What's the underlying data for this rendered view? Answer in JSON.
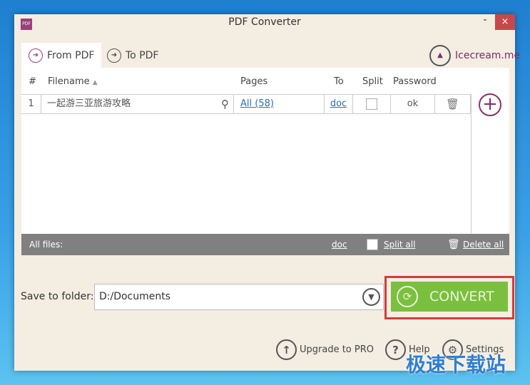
{
  "window": {
    "title": "PDF Converter",
    "icon_text": "PDF",
    "minimize": "-",
    "close": "×"
  },
  "tabs": [
    {
      "label": "From PDF",
      "active": true
    },
    {
      "label": "To PDF",
      "active": false
    }
  ],
  "brand": {
    "label": "Icecream.me"
  },
  "table": {
    "headers": {
      "num": "#",
      "filename": "Filename",
      "pages": "Pages",
      "to": "To",
      "split": "Split",
      "password": "Password"
    },
    "rows": [
      {
        "num": "1",
        "filename": "一起游三亚旅游攻略",
        "pages": "All (58)",
        "to": "doc",
        "split": false,
        "password": "ok"
      }
    ]
  },
  "footer": {
    "label": "All files:",
    "format": "doc",
    "split_all": "Split all",
    "delete_all": "Delete all"
  },
  "save": {
    "label": "Save to folder:",
    "value": "D:/Documents"
  },
  "convert_label": "CONVERT",
  "bottom": {
    "upgrade": "Upgrade to PRO",
    "help": "Help",
    "settings": "Settings"
  },
  "watermark": "极速下载站",
  "colors": {
    "accent": "#9b3f7a",
    "convert": "#7bbf3f",
    "highlight": "#d63b3b"
  }
}
